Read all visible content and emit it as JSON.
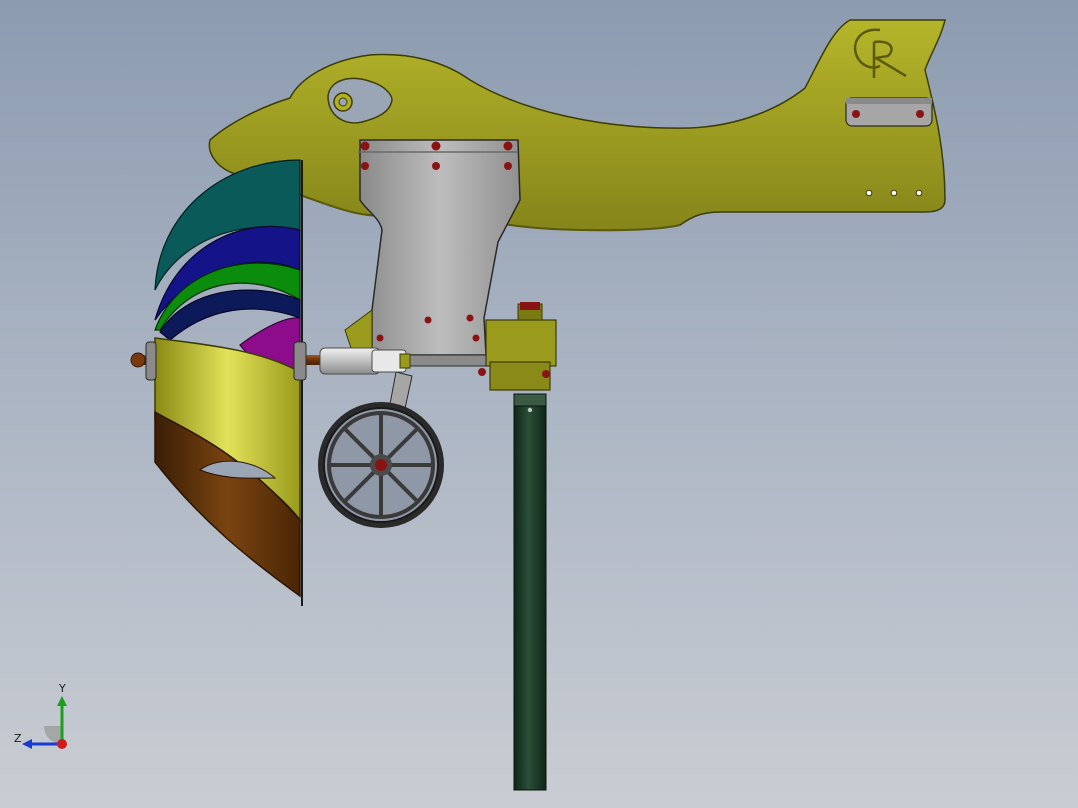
{
  "viewport": {
    "background_top": "#8c9bb0",
    "background_bottom": "#c9cdd3"
  },
  "model": {
    "body_color": "#9a9a1c",
    "body_edge_color": "#3c3c06",
    "bracket_color": "#a6a6a6",
    "bolt_color": "#8a1414",
    "pole_color": "#1e3a28",
    "blade_colors": [
      "#0a5a5a",
      "#141488",
      "#0c8c0c",
      "#8c0c8c",
      "#b0b020",
      "#5a300a"
    ],
    "logo_text": "PR",
    "icons": [
      "savonius-rotor-icon",
      "spoked-wheel-icon",
      "mounting-pole-icon"
    ]
  },
  "triad": {
    "y_label": "Y",
    "z_label": "Z",
    "y_color": "#1aa01a",
    "z_color": "#1a3ad0",
    "x_color": "#d01a1a"
  }
}
